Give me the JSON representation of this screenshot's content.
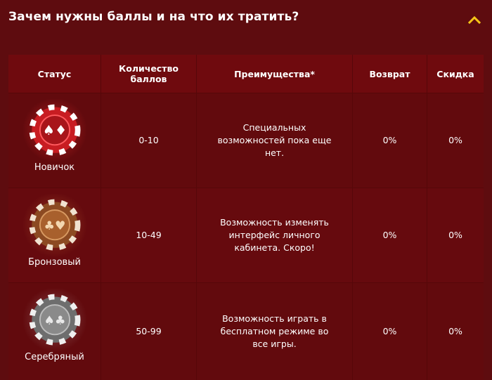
{
  "header": {
    "title": "Зачем нужны баллы и на что их тратить?",
    "collapse_icon": "chevron-up-icon",
    "accent_color": "#f5c518"
  },
  "table": {
    "columns": [
      "Статус",
      "Количество баллов",
      "Преимущества*",
      "Возврат",
      "Скидка"
    ],
    "rows": [
      {
        "status": "Новичок",
        "chip_icon": "red-poker-chip-icon",
        "chip_color": "#d8262a",
        "points": "0-10",
        "benefits": "Специальных возможностей пока еще нет.",
        "refund": "0%",
        "discount": "0%"
      },
      {
        "status": "Бронзовый",
        "chip_icon": "bronze-poker-chip-icon",
        "chip_color": "#a05a2c",
        "points": "10-49",
        "benefits": "Возможность изменять интерфейс личного кабинета. Скоро!",
        "refund": "0%",
        "discount": "0%"
      },
      {
        "status": "Серебряный",
        "chip_icon": "silver-poker-chip-icon",
        "chip_color": "#8a8a8a",
        "points": "50-99",
        "benefits": "Возможность играть в бесплатном режиме во все игры.",
        "refund": "0%",
        "discount": "0%"
      }
    ]
  }
}
